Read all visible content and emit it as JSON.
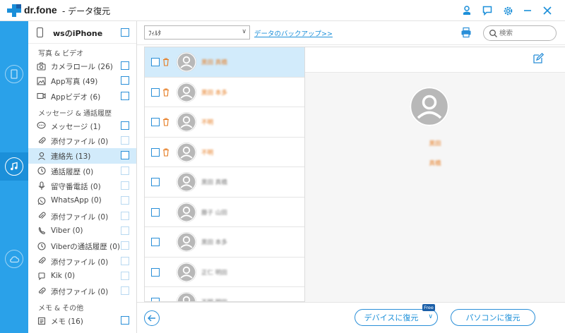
{
  "app": {
    "brand": "dr.fone",
    "title": "- データ復元"
  },
  "sidebar": {
    "device_name": "wsのiPhone",
    "sections": [
      {
        "title": "写真 & ビデオ",
        "items": [
          {
            "icon": "camera-icon",
            "label": "カメラロール (26)",
            "selected": false,
            "checkbox_active": true
          },
          {
            "icon": "photo-icon",
            "label": "App写真 (49)",
            "selected": false,
            "checkbox_active": true
          },
          {
            "icon": "video-icon",
            "label": "Appビデオ (6)",
            "selected": false,
            "checkbox_active": true
          }
        ]
      },
      {
        "title": "メッセージ & 通話履歴",
        "items": [
          {
            "icon": "message-icon",
            "label": "メッセージ (1)",
            "selected": false,
            "checkbox_active": true
          },
          {
            "icon": "attachment-icon",
            "label": "添付ファイル (0)",
            "selected": false,
            "checkbox_active": false
          },
          {
            "icon": "contact-icon",
            "label": "連絡先 (13)",
            "selected": true,
            "checkbox_active": true
          },
          {
            "icon": "clock-icon",
            "label": "通話履歴 (0)",
            "selected": false,
            "checkbox_active": false
          },
          {
            "icon": "microphone-icon",
            "label": "留守番電話 (0)",
            "selected": false,
            "checkbox_active": false
          },
          {
            "icon": "whatsapp-icon",
            "label": "WhatsApp (0)",
            "selected": false,
            "checkbox_active": false
          },
          {
            "icon": "attachment-icon",
            "label": "添付ファイル (0)",
            "selected": false,
            "checkbox_active": false
          },
          {
            "icon": "viber-icon",
            "label": "Viber (0)",
            "selected": false,
            "checkbox_active": false
          },
          {
            "icon": "clock-icon",
            "label": "Viberの通話履歴 (0)",
            "selected": false,
            "checkbox_active": false
          },
          {
            "icon": "attachment-icon",
            "label": "添付ファイル (0)",
            "selected": false,
            "checkbox_active": false
          },
          {
            "icon": "kik-icon",
            "label": "Kik (0)",
            "selected": false,
            "checkbox_active": false
          },
          {
            "icon": "attachment-icon",
            "label": "添付ファイル (0)",
            "selected": false,
            "checkbox_active": false
          }
        ]
      },
      {
        "title": "メモ & その他",
        "items": [
          {
            "icon": "memo-icon",
            "label": "メモ (16)",
            "selected": false,
            "checkbox_active": true
          }
        ]
      }
    ]
  },
  "toolbar": {
    "filter_value": "ﾌｨﾙﾀ",
    "backup_link": "データのバックアップ>>",
    "search_placeholder": "検索"
  },
  "contacts": [
    {
      "name": "黒田 真橋",
      "selected": true,
      "deleted": true
    },
    {
      "name": "黒田 本多",
      "selected": false,
      "deleted": true
    },
    {
      "name": "不明",
      "selected": false,
      "deleted": true
    },
    {
      "name": "不明",
      "selected": false,
      "deleted": true
    },
    {
      "name": "黒田 真橋",
      "selected": false,
      "deleted": false
    },
    {
      "name": "藤子 山田",
      "selected": false,
      "deleted": false
    },
    {
      "name": "黒田 本多",
      "selected": false,
      "deleted": false
    },
    {
      "name": "正仁 明田",
      "selected": false,
      "deleted": false
    },
    {
      "name": "不明 明田",
      "selected": false,
      "deleted": false
    }
  ],
  "detail": {
    "first_name": "黒田",
    "last_name": "真橋"
  },
  "bottom": {
    "restore_device_label": "デバイスに復元",
    "free_badge": "Free",
    "restore_pc_label": "パソコンに復元"
  },
  "colors": {
    "accent": "#2aa1e9",
    "selection": "#d2ebfb",
    "deleted_name": "#e67a1e"
  }
}
